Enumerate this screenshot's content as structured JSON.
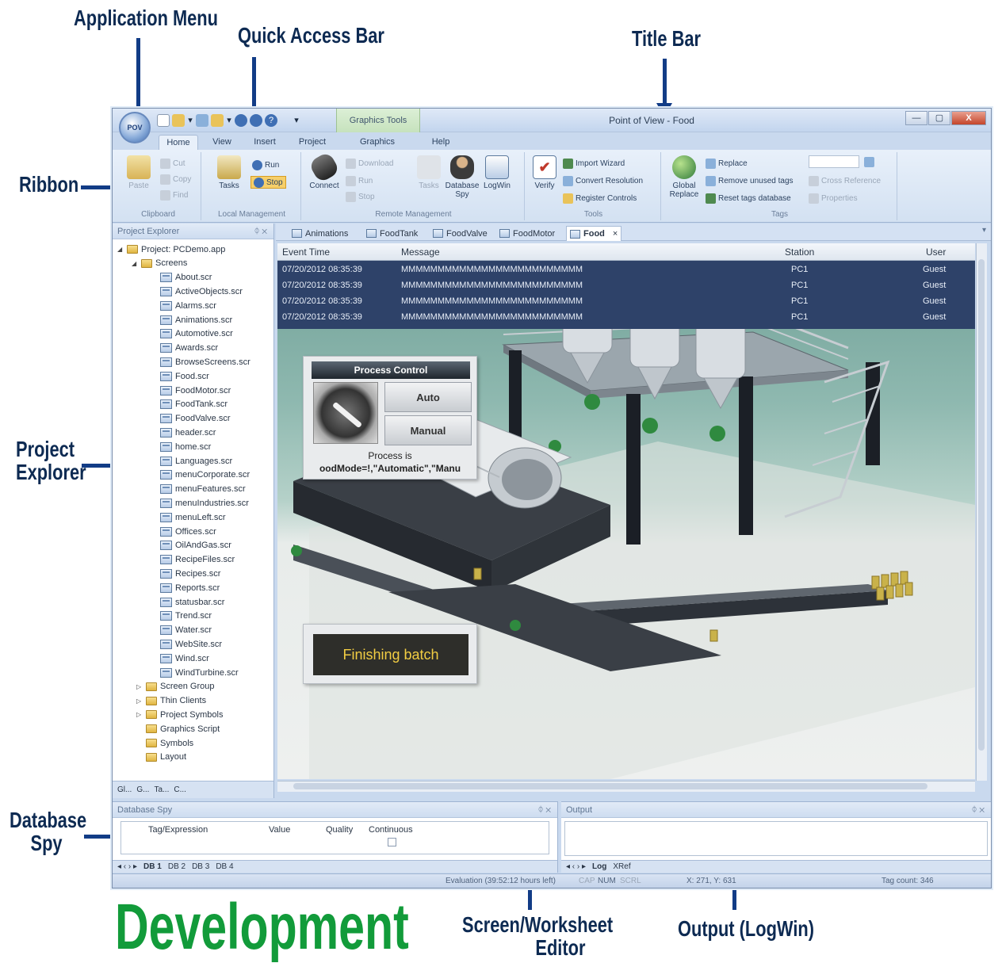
{
  "callouts": {
    "application_menu": "Application Menu",
    "quick_access_bar": "Quick Access Bar",
    "title_bar": "Title Bar",
    "ribbon": "Ribbon",
    "project_explorer_line1": "Project",
    "project_explorer_line2": "Explorer",
    "database_spy_line1": "Database",
    "database_spy_line2": "Spy",
    "screen_editor_line1": "Screen/Worksheet",
    "screen_editor_line2": "Editor",
    "output_logwin": "Output (LogWin)",
    "development": "Development"
  },
  "window": {
    "title": "Point of View - Food",
    "app_orb": "POV",
    "contextual_tab": "Graphics Tools",
    "buttons": {
      "minimize": "—",
      "maximize": "▢",
      "close": "X"
    }
  },
  "ribbon": {
    "tabs": [
      "Home",
      "View",
      "Insert",
      "Project",
      "Graphics",
      "Help"
    ],
    "clipboard": {
      "paste": "Paste",
      "cut": "Cut",
      "copy": "Copy",
      "find": "Find",
      "label": "Clipboard"
    },
    "local_management": {
      "tasks": "Tasks",
      "run": "Run",
      "stop": "Stop",
      "label": "Local Management"
    },
    "remote_management": {
      "connect": "Connect",
      "download": "Download",
      "run": "Run",
      "stop": "Stop",
      "tasks": "Tasks",
      "database_spy": "Database Spy",
      "logwin": "LogWin",
      "label": "Remote Management"
    },
    "tools": {
      "verify": "Verify",
      "import_wizard": "Import Wizard",
      "convert_resolution": "Convert Resolution",
      "register_controls": "Register Controls",
      "label": "Tools"
    },
    "tags": {
      "global_replace": "Global Replace",
      "replace": "Replace",
      "remove_unused_tags": "Remove unused tags",
      "reset_tags_database": "Reset tags database",
      "cross_reference": "Cross Reference",
      "properties": "Properties",
      "label": "Tags"
    }
  },
  "explorer": {
    "title": "Project Explorer",
    "project": "Project: PCDemo.app",
    "screens_folder": "Screens",
    "screens": [
      "About.scr",
      "ActiveObjects.scr",
      "Alarms.scr",
      "Animations.scr",
      "Automotive.scr",
      "Awards.scr",
      "BrowseScreens.scr",
      "Food.scr",
      "FoodMotor.scr",
      "FoodTank.scr",
      "FoodValve.scr",
      "header.scr",
      "home.scr",
      "Languages.scr",
      "menuCorporate.scr",
      "menuFeatures.scr",
      "menuIndustries.scr",
      "menuLeft.scr",
      "Offices.scr",
      "OilAndGas.scr",
      "RecipeFiles.scr",
      "Recipes.scr",
      "Reports.scr",
      "statusbar.scr",
      "Trend.scr",
      "Water.scr",
      "WebSite.scr",
      "Wind.scr",
      "WindTurbine.scr"
    ],
    "other_items": [
      "Screen Group",
      "Thin Clients",
      "Project Symbols",
      "Graphics Script",
      "Symbols",
      "Layout"
    ],
    "bottom_tabs": [
      "Gl...",
      "G...",
      "Ta...",
      "C..."
    ]
  },
  "doc_tabs": [
    "Animations",
    "FoodTank",
    "FoodValve",
    "FoodMotor",
    "Food"
  ],
  "alarm_grid": {
    "headers": {
      "time": "Event Time",
      "message": "Message",
      "station": "Station",
      "user": "User"
    },
    "rows": [
      {
        "time": "07/20/2012 08:35:39",
        "message": "MMMMMMMMMMMMMMMMMMMMMMMMM",
        "station": "PC1",
        "user": "Guest"
      },
      {
        "time": "07/20/2012 08:35:39",
        "message": "MMMMMMMMMMMMMMMMMMMMMMMMM",
        "station": "PC1",
        "user": "Guest"
      },
      {
        "time": "07/20/2012 08:35:39",
        "message": "MMMMMMMMMMMMMMMMMMMMMMMMM",
        "station": "PC1",
        "user": "Guest"
      },
      {
        "time": "07/20/2012 08:35:39",
        "message": "MMMMMMMMMMMMMMMMMMMMMMMMM",
        "station": "PC1",
        "user": "Guest"
      }
    ]
  },
  "process_control": {
    "title": "Process Control",
    "auto": "Auto",
    "manual": "Manual",
    "status_line1": "Process is",
    "status_line2": "oodMode=!,\"Automatic\",\"Manu"
  },
  "batch_status": "Finishing batch",
  "database_spy": {
    "title": "Database Spy",
    "columns": [
      "Tag/Expression",
      "Value",
      "Quality",
      "Continuous"
    ],
    "tabs": [
      "DB 1",
      "DB 2",
      "DB 3",
      "DB 4"
    ]
  },
  "output": {
    "title": "Output",
    "tabs": [
      "Log",
      "XRef"
    ]
  },
  "statusbar": {
    "evaluation": "Evaluation (39:52:12 hours left)",
    "cap": "CAP",
    "num": "NUM",
    "scrl": "SCRL",
    "coords": "X: 271, Y: 631",
    "tag_count": "Tag count: 346"
  },
  "colors": {
    "accent": "#123c86",
    "title_green": "#129b3a",
    "alarm_bg": "#2e4269",
    "batch_text": "#f2cd43"
  }
}
